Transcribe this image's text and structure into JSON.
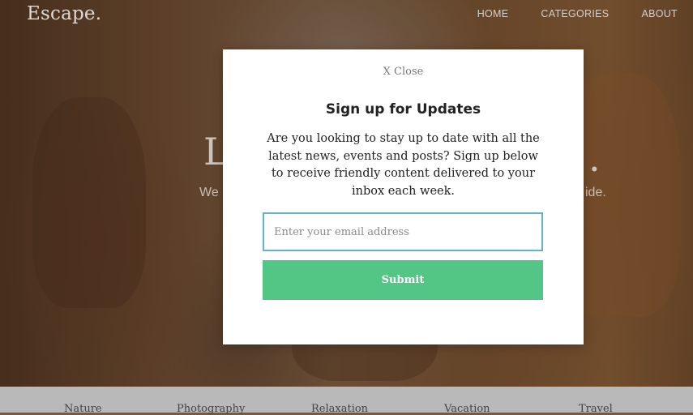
{
  "header": {
    "logo": "Escape.",
    "nav": [
      "HOME",
      "CATEGORIES",
      "ABOUT"
    ]
  },
  "hero": {
    "title_visible": "L",
    "title_tail": ".",
    "subtitle_left": "We",
    "subtitle_right": "ide."
  },
  "modal": {
    "close_label": "X Close",
    "title": "Sign up for Updates",
    "description": "Are you looking to stay up to date with all the latest news, events and posts? Sign up below to receive friendly content delivered to your inbox each week.",
    "email_placeholder": "Enter your email address",
    "submit_label": "Submit"
  },
  "categories": [
    "Nature",
    "Photography",
    "Relaxation",
    "Vacation",
    "Travel"
  ],
  "colors": {
    "submit_bg": "#53c685",
    "input_border": "#5fb4c8"
  }
}
